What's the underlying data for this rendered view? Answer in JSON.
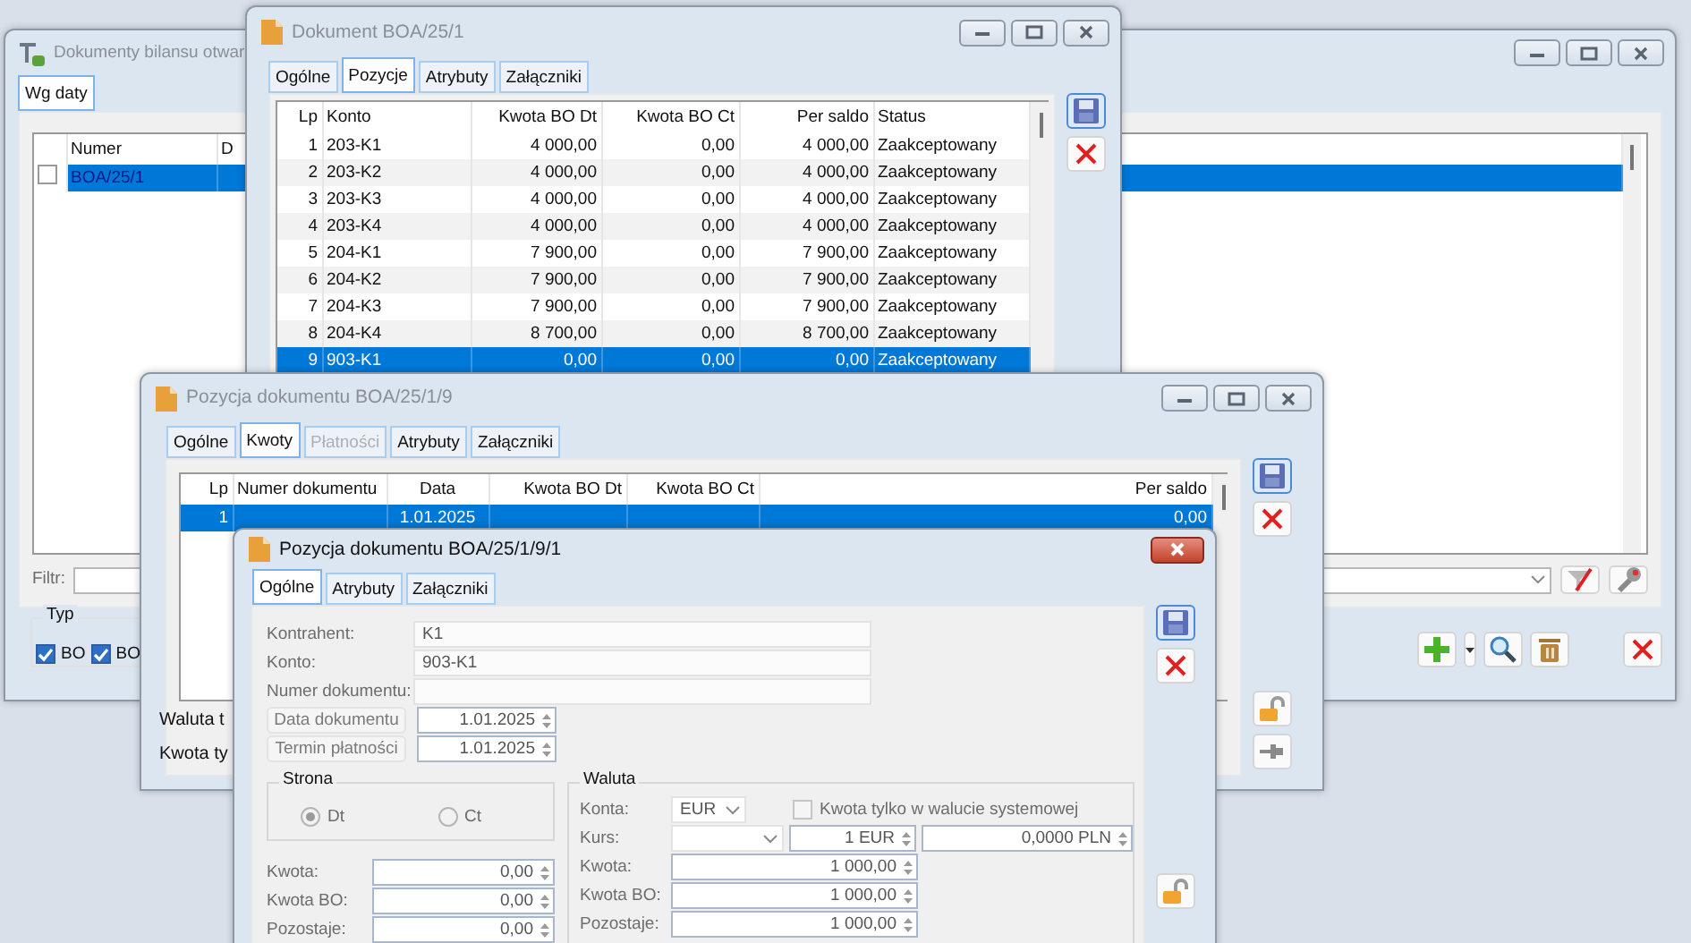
{
  "main_window": {
    "title": "Dokumenty bilansu otwar",
    "active": false,
    "tabs": [
      {
        "label": "Wg daty",
        "selected": true
      }
    ],
    "list": {
      "columns": [
        "Numer",
        "D"
      ],
      "rows": [
        {
          "checked": false,
          "selected": true,
          "cells": [
            "BOA/25/1"
          ]
        }
      ]
    },
    "filter_label": "Filtr:",
    "type_group": {
      "title": "Typ",
      "options": [
        {
          "label": "BO",
          "checked": true
        },
        {
          "label": "BO",
          "checked": true
        }
      ]
    }
  },
  "document_window": {
    "title": "Dokument BOA/25/1",
    "active": false,
    "tabs": [
      {
        "label": "Ogólne",
        "selected": false
      },
      {
        "label": "Pozycje",
        "selected": true
      },
      {
        "label": "Atrybuty",
        "selected": false
      },
      {
        "label": "Załączniki",
        "selected": false
      }
    ],
    "table": {
      "columns": [
        "Lp",
        "Konto",
        "Kwota BO Dt",
        "Kwota BO Ct",
        "Per saldo",
        "Status"
      ],
      "rows": [
        {
          "selected": false,
          "cells": [
            "1",
            "203-K1",
            "4 000,00",
            "0,00",
            "4 000,00",
            "Zaakceptowany"
          ]
        },
        {
          "selected": false,
          "cells": [
            "2",
            "203-K2",
            "4 000,00",
            "0,00",
            "4 000,00",
            "Zaakceptowany"
          ]
        },
        {
          "selected": false,
          "cells": [
            "3",
            "203-K3",
            "4 000,00",
            "0,00",
            "4 000,00",
            "Zaakceptowany"
          ]
        },
        {
          "selected": false,
          "cells": [
            "4",
            "203-K4",
            "4 000,00",
            "0,00",
            "4 000,00",
            "Zaakceptowany"
          ]
        },
        {
          "selected": false,
          "cells": [
            "5",
            "204-K1",
            "7 900,00",
            "0,00",
            "7 900,00",
            "Zaakceptowany"
          ]
        },
        {
          "selected": false,
          "cells": [
            "6",
            "204-K2",
            "7 900,00",
            "0,00",
            "7 900,00",
            "Zaakceptowany"
          ]
        },
        {
          "selected": false,
          "cells": [
            "7",
            "204-K3",
            "7 900,00",
            "0,00",
            "7 900,00",
            "Zaakceptowany"
          ]
        },
        {
          "selected": false,
          "cells": [
            "8",
            "204-K4",
            "8 700,00",
            "0,00",
            "8 700,00",
            "Zaakceptowany"
          ]
        },
        {
          "selected": true,
          "cells": [
            "9",
            "903-K1",
            "0,00",
            "0,00",
            "0,00",
            "Zaakceptowany"
          ]
        }
      ]
    }
  },
  "position_window": {
    "title": "Pozycja dokumentu BOA/25/1/9",
    "active": false,
    "tabs": [
      {
        "label": "Ogólne",
        "selected": false,
        "disabled": false
      },
      {
        "label": "Kwoty",
        "selected": true,
        "disabled": false
      },
      {
        "label": "Płatności",
        "selected": false,
        "disabled": true
      },
      {
        "label": "Atrybuty",
        "selected": false,
        "disabled": false
      },
      {
        "label": "Załączniki",
        "selected": false,
        "disabled": false
      }
    ],
    "table": {
      "columns": [
        "Lp",
        "Numer dokumentu",
        "Data",
        "Kwota BO Dt",
        "Kwota BO Ct",
        "Per saldo"
      ],
      "rows": [
        {
          "selected": true,
          "cells": [
            "1",
            null,
            "1.01.2025",
            null,
            null,
            "0,00"
          ]
        }
      ]
    },
    "labels": [
      "Waluta t",
      "Kwota ty"
    ]
  },
  "subposition_window": {
    "title": "Pozycja dokumentu BOA/25/1/9/1",
    "active": true,
    "tabs": [
      {
        "label": "Ogólne",
        "selected": true
      },
      {
        "label": "Atrybuty",
        "selected": false
      },
      {
        "label": "Załączniki",
        "selected": false
      }
    ],
    "fields": [
      {
        "label": "Kontrahent:",
        "value": "K1"
      },
      {
        "label": "Konto:",
        "value": "903-K1"
      },
      {
        "label": "Numer dokumentu:"
      }
    ],
    "dates": [
      {
        "label": "Data dokumentu",
        "value": "1.01.2025"
      },
      {
        "label": "Termin płatności",
        "value": "1.01.2025"
      }
    ],
    "side": {
      "title": "Strona",
      "options": [
        {
          "label": "Dt",
          "selected": true
        },
        {
          "label": "Ct",
          "selected": false
        }
      ]
    },
    "amounts": [
      {
        "label": "Kwota:",
        "value": "0,00"
      },
      {
        "label": "Kwota BO:",
        "value": "0,00"
      },
      {
        "label": "Pozostaje:",
        "value": "0,00"
      }
    ],
    "currency": {
      "title": "Waluta",
      "account_label": "Konta:",
      "account_currency": "EUR",
      "system_only": {
        "label": "Kwota tylko w walucie systemowej",
        "checked": false
      },
      "rate_label": "Kurs:",
      "rate_unit": "1 EUR",
      "rate_value": "0,0000 PLN",
      "amounts": [
        {
          "label": "Kwota:",
          "value": "1 000,00"
        },
        {
          "label": "Kwota BO:",
          "value": "1 000,00"
        },
        {
          "label": "Pozostaje:",
          "value": "1 000,00"
        }
      ]
    }
  }
}
